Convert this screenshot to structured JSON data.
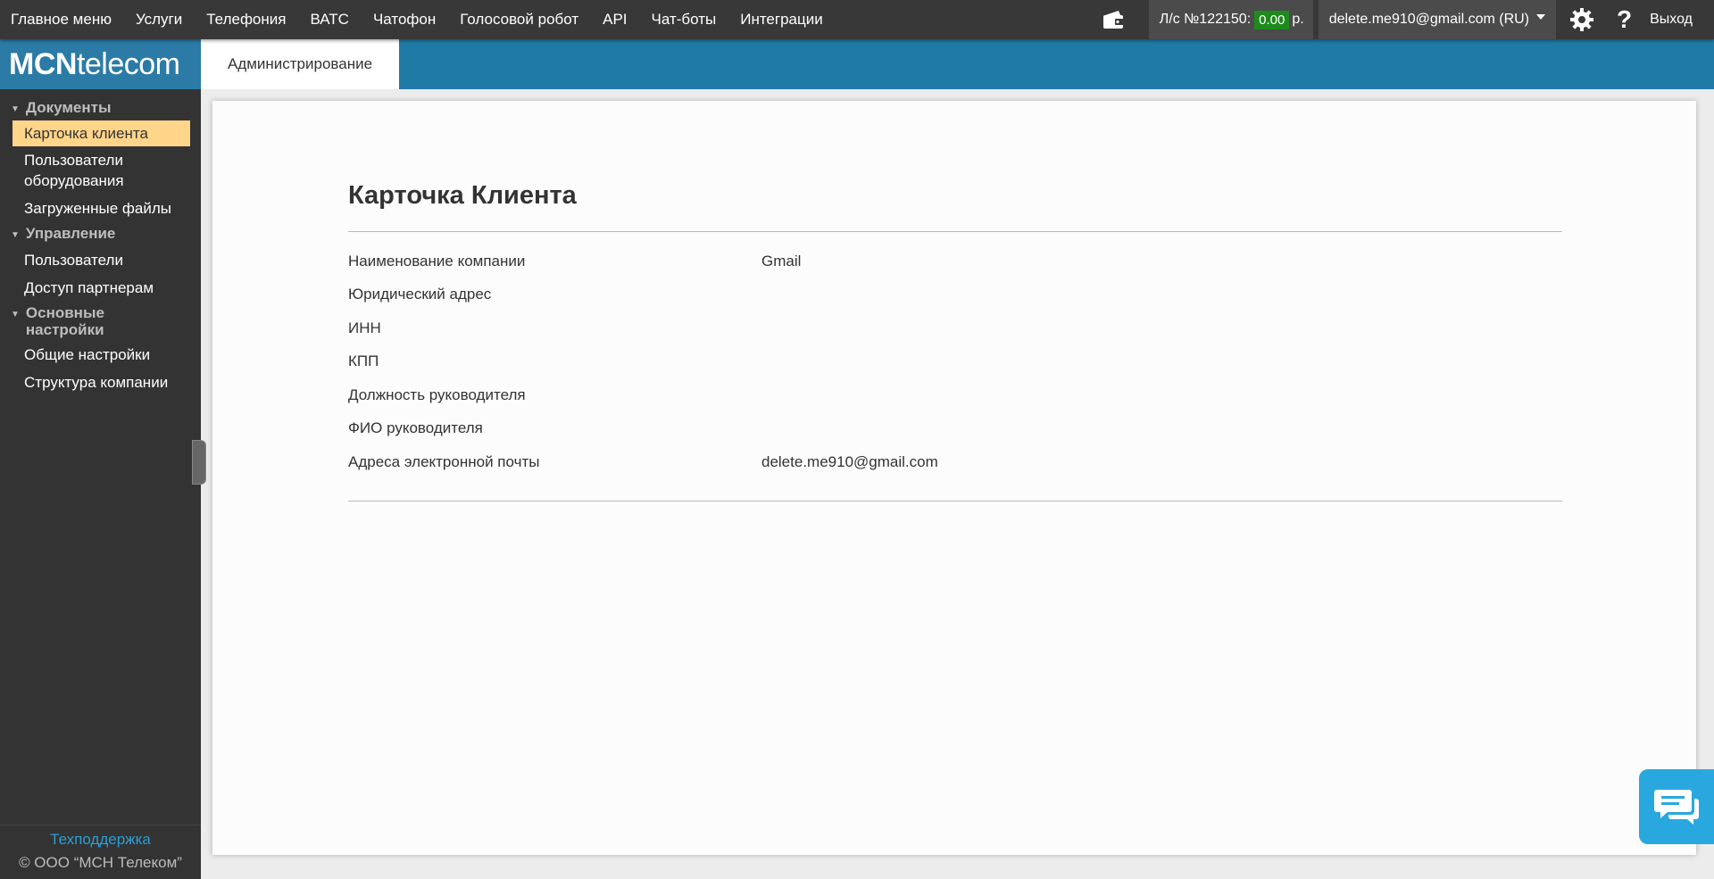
{
  "topnav": {
    "items": [
      "Главное меню",
      "Услуги",
      "Телефония",
      "ВАТС",
      "Чатофон",
      "Голосовой робот",
      "API",
      "Чат-боты",
      "Интеграции"
    ]
  },
  "account": {
    "label": "Л/с №122150:",
    "balance": "0.00",
    "currency": "р.",
    "balance_color": "#1e8a1e"
  },
  "user": {
    "email": "delete.me910@gmail.com (RU)"
  },
  "icons": {
    "wallet": "wallet-icon",
    "settings": "gear-icon",
    "help": "?"
  },
  "logout": "Выход",
  "logo": {
    "bold": "MCN",
    "light": "telecom"
  },
  "header": {
    "tab": "Администрирование",
    "band_color": "#1f7aa5"
  },
  "sidebar": {
    "sections": [
      {
        "title": "Документы",
        "items": [
          "Карточка клиента",
          "Пользователи оборудования",
          "Загруженные файлы"
        ]
      },
      {
        "title": "Управление",
        "items": [
          "Пользователи",
          "Доступ партнерам"
        ]
      },
      {
        "title": "Основные настройки",
        "items": [
          "Общие настройки",
          "Структура компании"
        ]
      }
    ],
    "active": "Карточка клиента",
    "support": "Техподдержка",
    "copyright": "© ООО “МСН Телеком”"
  },
  "card": {
    "title": "Карточка Клиента",
    "rows": [
      {
        "label": "Наименование компании",
        "value": "Gmail"
      },
      {
        "label": "Юридический адрес",
        "value": ""
      },
      {
        "label": "ИНН",
        "value": ""
      },
      {
        "label": "КПП",
        "value": ""
      },
      {
        "label": "Должность руководителя",
        "value": ""
      },
      {
        "label": "ФИО руководителя",
        "value": ""
      },
      {
        "label": "Адреса электронной почты",
        "value": "delete.me910@gmail.com"
      }
    ]
  },
  "chat_icon": "chat-bubbles-icon"
}
